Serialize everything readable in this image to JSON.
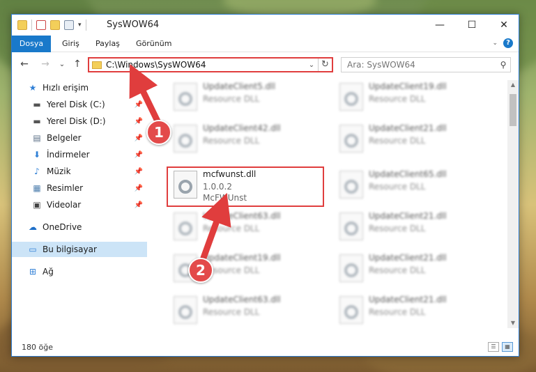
{
  "window": {
    "title": "SysWOW64",
    "controls": {
      "minimize": "—",
      "maximize": "☐",
      "close": "✕"
    }
  },
  "ribbon": {
    "tabs": [
      {
        "label": "Dosya",
        "active": true
      },
      {
        "label": "Giriş",
        "active": false
      },
      {
        "label": "Paylaş",
        "active": false
      },
      {
        "label": "Görünüm",
        "active": false
      }
    ]
  },
  "navigation": {
    "back": "←",
    "forward": "→",
    "recent": "⌄",
    "up": "↑",
    "address": "C:\\Windows\\SysWOW64",
    "refresh": "↻",
    "dropdown": "⌄",
    "search_placeholder": "Ara: SysWOW64"
  },
  "sidebar": {
    "items": [
      {
        "label": "Hızlı erişim",
        "icon": "star-icon",
        "glyph": "★",
        "color": "#2f7fd6",
        "pinned": false
      },
      {
        "label": "Yerel Disk (C:)",
        "icon": "drive-icon",
        "glyph": "▬",
        "color": "#555555",
        "pinned": true
      },
      {
        "label": "Yerel Disk (D:)",
        "icon": "drive-icon",
        "glyph": "▬",
        "color": "#555555",
        "pinned": true
      },
      {
        "label": "Belgeler",
        "icon": "documents-icon",
        "glyph": "▤",
        "color": "#5b6f86",
        "pinned": true
      },
      {
        "label": "İndirmeler",
        "icon": "download-icon",
        "glyph": "⬇",
        "color": "#2f7fd6",
        "pinned": true
      },
      {
        "label": "Müzik",
        "icon": "music-icon",
        "glyph": "♪",
        "color": "#2f7fd6",
        "pinned": true
      },
      {
        "label": "Resimler",
        "icon": "pictures-icon",
        "glyph": "▦",
        "color": "#4f7fae",
        "pinned": true
      },
      {
        "label": "Videolar",
        "icon": "video-icon",
        "glyph": "▣",
        "color": "#444444",
        "pinned": true
      },
      {
        "label": "OneDrive",
        "icon": "cloud-icon",
        "glyph": "☁",
        "color": "#1d6ec8",
        "pinned": false
      },
      {
        "label": "Bu bilgisayar",
        "icon": "computer-icon",
        "glyph": "▭",
        "color": "#2f7fd6",
        "pinned": false,
        "selected": true
      },
      {
        "label": "Ağ",
        "icon": "network-icon",
        "glyph": "⊞",
        "color": "#2f7fd6",
        "pinned": false
      }
    ],
    "pin_glyph": "📌"
  },
  "files": [
    {
      "name": "UpdateClient5.dll",
      "desc": "Resource DLL",
      "col": 0,
      "row": 0,
      "blur": true
    },
    {
      "name": "UpdateClient19.dll",
      "desc": "Resource DLL",
      "col": 1,
      "row": 0,
      "blur": true
    },
    {
      "name": "UpdateClient42.dll",
      "desc": "Resource DLL",
      "col": 0,
      "row": 1,
      "blur": true
    },
    {
      "name": "UpdateClient21.dll",
      "desc": "Resource DLL",
      "col": 1,
      "row": 1,
      "blur": true
    },
    {
      "name": "mcfwunst.dll",
      "desc": "1.0.0.2",
      "desc2": "McFWUnst",
      "col": 0,
      "row": 2,
      "blur": false
    },
    {
      "name": "UpdateClient65.dll",
      "desc": "Resource DLL",
      "col": 1,
      "row": 2,
      "blur": true
    },
    {
      "name": "UpdateClient63.dll",
      "desc": "Resource DLL",
      "col": 0,
      "row": 3,
      "blur": true
    },
    {
      "name": "UpdateClient21.dll",
      "desc": "Resource DLL",
      "col": 1,
      "row": 3,
      "blur": true
    },
    {
      "name": "UpdateClient19.dll",
      "desc": "Resource DLL",
      "col": 0,
      "row": 4,
      "blur": true
    },
    {
      "name": "UpdateClient21.dll",
      "desc": "Resource DLL",
      "col": 1,
      "row": 4,
      "blur": true
    },
    {
      "name": "UpdateClient63.dll",
      "desc": "Resource DLL",
      "col": 0,
      "row": 5,
      "blur": true
    },
    {
      "name": "UpdateClient21.dll",
      "desc": "Resource DLL",
      "col": 1,
      "row": 5,
      "blur": true
    }
  ],
  "status": {
    "count": "180 öğe"
  },
  "annotations": {
    "step1": "1",
    "step2": "2",
    "color": "#e03d3d"
  }
}
